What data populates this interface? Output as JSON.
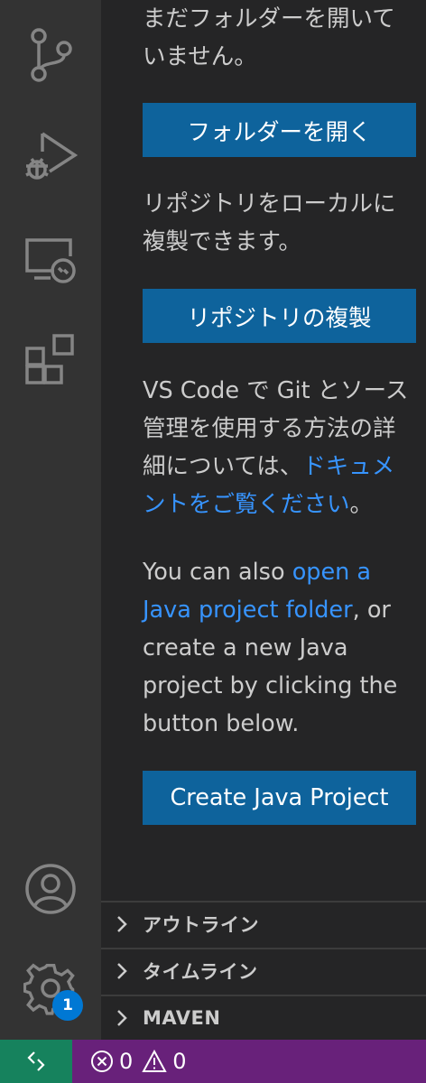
{
  "activity_bar": {
    "icons": [
      "source-control-icon",
      "run-debug-icon",
      "remote-explorer-icon",
      "extensions-icon",
      "account-icon",
      "manage-gear-icon"
    ],
    "settings_badge": "1"
  },
  "sidebar": {
    "text_no_folder": "まだフォルダーを開いていません。",
    "open_folder_button": "フォルダーを開く",
    "text_clone": "リポジトリをローカルに複製できます。",
    "clone_button": "リポジトリの複製",
    "text_git_pre": "VS Code で Git とソース管理を使用する方法の詳細については、",
    "text_git_link": "ドキュメントをご覧ください",
    "text_git_post": "。",
    "text_java_pre": "You can also ",
    "text_java_link": "open a Java project folder",
    "text_java_post": ", or create a new Java project by clicking the button below.",
    "create_java_button": "Create Java Project"
  },
  "panels": [
    {
      "title": "アウトライン"
    },
    {
      "title": "タイムライン"
    },
    {
      "title": "MAVEN"
    }
  ],
  "status_bar": {
    "errors": "0",
    "warnings": "0"
  },
  "colors": {
    "activity_bar": "#333333",
    "sidebar": "#252526",
    "button": "#0e639c",
    "link": "#3794ff",
    "status_bar": "#68217a",
    "remote": "#16825d",
    "badge": "#0078d4"
  }
}
